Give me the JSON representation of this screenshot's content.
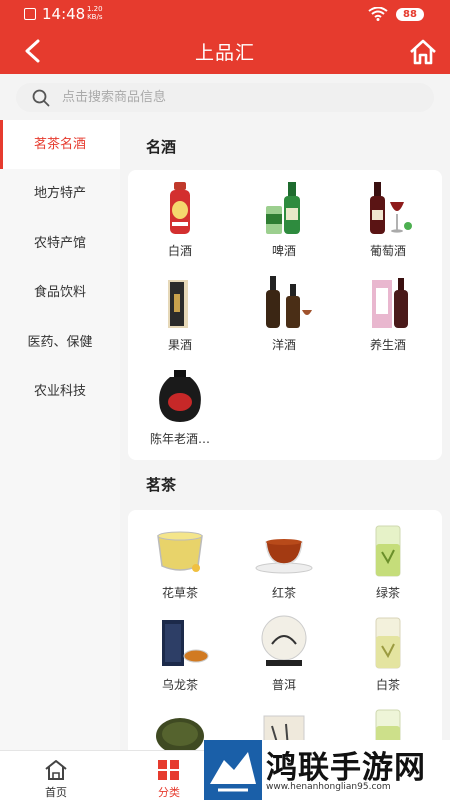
{
  "status_bar": {
    "time": "14:48",
    "speed_value": "1.20",
    "speed_unit": "KB/s",
    "battery": "88"
  },
  "header": {
    "title": "上品汇"
  },
  "search": {
    "placeholder": "点击搜索商品信息"
  },
  "sidebar": {
    "items": [
      {
        "label": "茗茶名酒",
        "active": true
      },
      {
        "label": "地方特产"
      },
      {
        "label": "农特产馆"
      },
      {
        "label": "食品饮料"
      },
      {
        "label": "医药、保健"
      },
      {
        "label": "农业科技"
      }
    ]
  },
  "sections": [
    {
      "title": "名酒",
      "items": [
        {
          "label": "白酒",
          "icon": "baijiu-bottle-icon"
        },
        {
          "label": "啤酒",
          "icon": "beer-icon"
        },
        {
          "label": "葡萄酒",
          "icon": "wine-icon"
        },
        {
          "label": "果酒",
          "icon": "fruit-wine-icon"
        },
        {
          "label": "洋酒",
          "icon": "liquor-icon"
        },
        {
          "label": "养生酒",
          "icon": "health-wine-icon"
        },
        {
          "label": "陈年老酒…",
          "icon": "aged-wine-jar-icon"
        }
      ]
    },
    {
      "title": "茗茶",
      "items": [
        {
          "label": "花草茶",
          "icon": "flower-tea-icon"
        },
        {
          "label": "红茶",
          "icon": "black-tea-icon"
        },
        {
          "label": "绿茶",
          "icon": "green-tea-icon"
        },
        {
          "label": "乌龙茶",
          "icon": "oolong-tea-icon"
        },
        {
          "label": "普洱",
          "icon": "puer-tea-icon"
        },
        {
          "label": "白茶",
          "icon": "white-tea-icon"
        }
      ]
    }
  ],
  "bottom_nav": [
    {
      "label": "首页",
      "icon": "home-icon"
    },
    {
      "label": "分类",
      "icon": "category-icon",
      "active": true
    }
  ],
  "watermark": {
    "text": "鸿联手游网",
    "url": "www.henanhonglian95.com"
  },
  "colors": {
    "accent": "#e63b2e",
    "background": "#f4f4f4"
  }
}
